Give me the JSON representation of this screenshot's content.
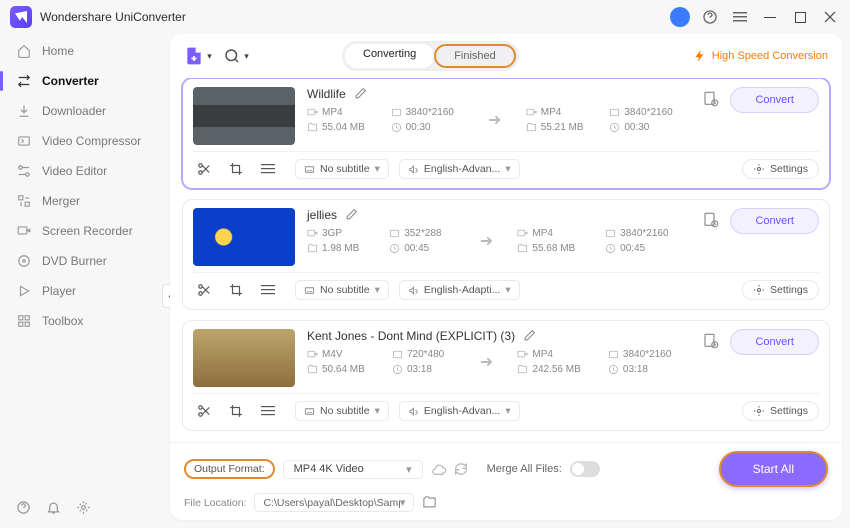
{
  "app": {
    "title": "Wondershare UniConverter"
  },
  "sidebar": {
    "items": [
      {
        "label": "Home"
      },
      {
        "label": "Converter"
      },
      {
        "label": "Downloader"
      },
      {
        "label": "Video Compressor"
      },
      {
        "label": "Video Editor"
      },
      {
        "label": "Merger"
      },
      {
        "label": "Screen Recorder"
      },
      {
        "label": "DVD Burner"
      },
      {
        "label": "Player"
      },
      {
        "label": "Toolbox"
      }
    ]
  },
  "toolbar": {
    "tabs": {
      "converting": "Converting",
      "finished": "Finished"
    },
    "hispeed": "High Speed Conversion"
  },
  "items": [
    {
      "title": "Wildlife",
      "src": {
        "format": "MP4",
        "res": "3840*2160",
        "size": "55.04 MB",
        "dur": "00:30"
      },
      "dst": {
        "format": "MP4",
        "res": "3840*2160",
        "size": "55.21 MB",
        "dur": "00:30"
      },
      "subtitle": "No subtitle",
      "audio": "English-Advan...",
      "convert": "Convert",
      "settings": "Settings"
    },
    {
      "title": "jellies",
      "src": {
        "format": "3GP",
        "res": "352*288",
        "size": "1.98 MB",
        "dur": "00:45"
      },
      "dst": {
        "format": "MP4",
        "res": "3840*2160",
        "size": "55.68 MB",
        "dur": "00:45"
      },
      "subtitle": "No subtitle",
      "audio": "English-Adapti...",
      "convert": "Convert",
      "settings": "Settings"
    },
    {
      "title": "Kent Jones - Dont Mind (EXPLICIT) (3)",
      "src": {
        "format": "M4V",
        "res": "720*480",
        "size": "50.64 MB",
        "dur": "03:18"
      },
      "dst": {
        "format": "MP4",
        "res": "3840*2160",
        "size": "242.56 MB",
        "dur": "03:18"
      },
      "subtitle": "No subtitle",
      "audio": "English-Advan...",
      "convert": "Convert",
      "settings": "Settings"
    }
  ],
  "footer": {
    "output_format_label": "Output Format:",
    "output_format_value": "MP4 4K Video",
    "merge_label": "Merge All Files:",
    "start_all": "Start All",
    "file_location_label": "File Location:",
    "file_location_value": "C:\\Users\\payal\\Desktop\\Sampl"
  }
}
